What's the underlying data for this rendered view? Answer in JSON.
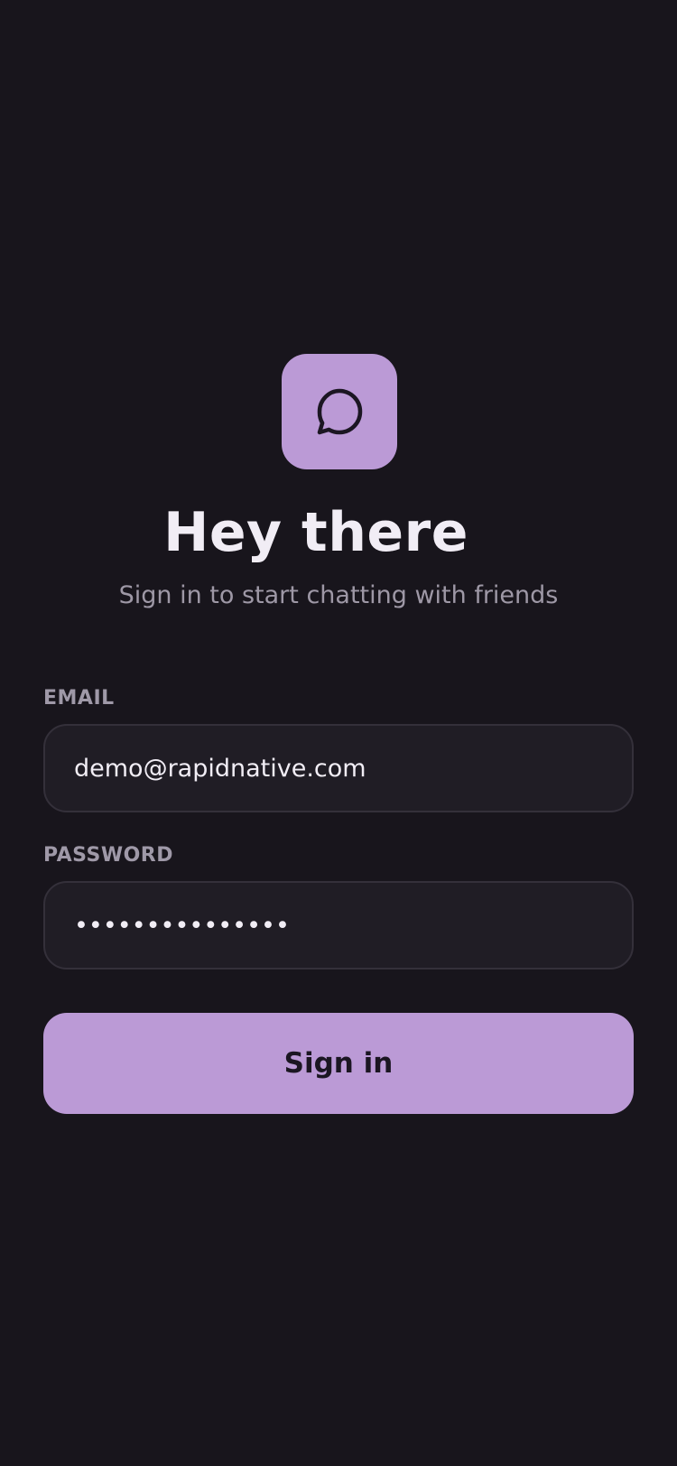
{
  "colors": {
    "background": "#18151c",
    "accent": "#bb9ad6",
    "field_background": "#201d25",
    "field_border": "#34303a",
    "title_text": "#f1edf5",
    "muted_text": "#9e98a6",
    "button_text": "#1b1622"
  },
  "brand": {
    "icon": "chat-bubble-icon"
  },
  "header": {
    "title": "Hey there",
    "subtitle": "Sign in to start chatting with friends"
  },
  "form": {
    "email": {
      "label": "EMAIL",
      "value": "demo@rapidnative.com"
    },
    "password": {
      "label": "PASSWORD",
      "value": "•••••••••••••••"
    },
    "submit_label": "Sign in"
  }
}
